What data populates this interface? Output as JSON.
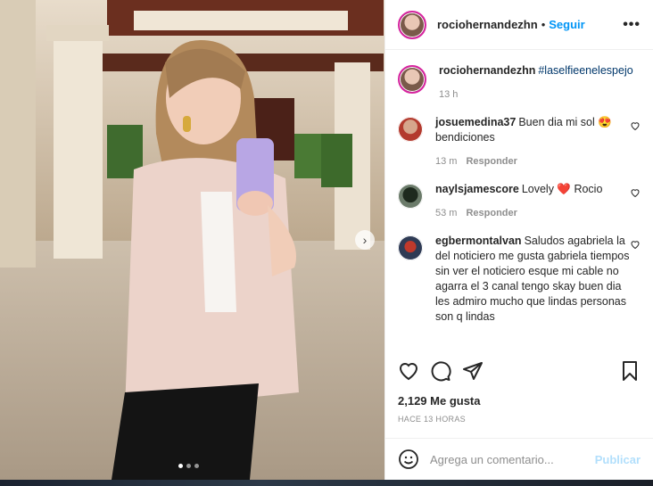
{
  "post": {
    "username": "rociohernandezhn",
    "follow_label": "Seguir",
    "more_label": "•••",
    "caption_user": "rociohernandezhn",
    "caption_tag": "#laselfieenelespejo",
    "caption_time": "13 h"
  },
  "comments": [
    {
      "user": "josuemedina37",
      "text": "Buen dia mi sol 😍 bendiciones",
      "time": "13 m",
      "reply": "Responder"
    },
    {
      "user": "naylsjamescore",
      "text": "Lovely ❤️ Rocio",
      "time": "53 m",
      "reply": "Responder"
    },
    {
      "user": "egbermontalvan",
      "text": "Saludos agabriela la del noticiero me gusta gabriela tiempos sin ver el noticiero esque mi cable no agarra el 3 canal tengo skay buen dia les admiro mucho que lindas personas son q lindas",
      "time": "",
      "reply": ""
    }
  ],
  "engagement": {
    "likes": "2,129 Me gusta",
    "posted": "HACE 13 HORAS"
  },
  "composer": {
    "placeholder": "Agrega un comentario...",
    "publish_label": "Publicar"
  },
  "icons": {
    "like": "heart-icon",
    "comment": "comment-bubble-icon",
    "share": "paper-plane-icon",
    "save": "bookmark-icon",
    "emoji": "emoji-icon",
    "next": "chevron-right-icon"
  },
  "colors": {
    "accent": "#0095f6",
    "publish_disabled": "#b2dffc",
    "heart_red": "#ed4956"
  },
  "carousel": {
    "slide_count": 3,
    "active_index": 0
  }
}
